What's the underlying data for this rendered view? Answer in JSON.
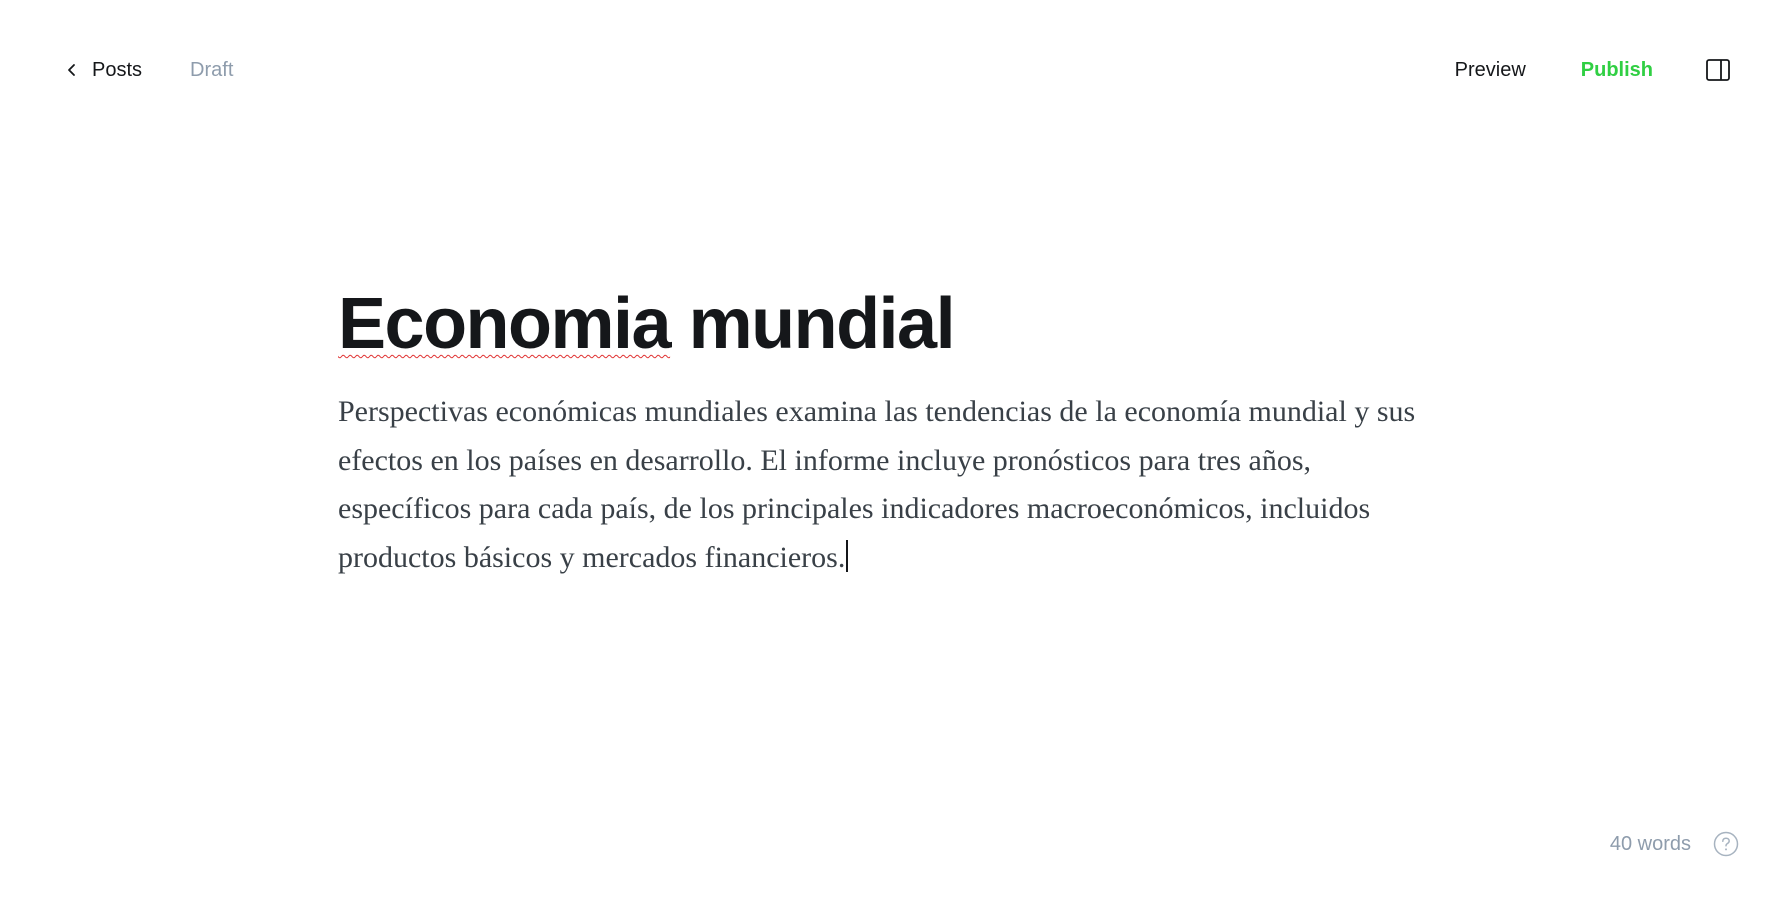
{
  "header": {
    "back_label": "Posts",
    "status": "Draft",
    "preview_label": "Preview",
    "publish_label": "Publish",
    "back_icon": "chevron-left-icon",
    "sidebar_icon": "sidebar-panel-icon"
  },
  "post": {
    "title_part1": "Economia",
    "title_part2": " mundial",
    "body": "Perspectivas económicas mundiales examina las tendencias de la economía mundial y sus efectos en los países en desarrollo. El informe incluye pronósticos para tres años, específicos para cada país, de los principales indicadores macroeconómicos, incluidos productos básicos y mercados financieros."
  },
  "footer": {
    "word_count": "40 words",
    "help_icon": "question-circle-icon"
  },
  "colors": {
    "publish": "#30cf43",
    "muted": "#8e9cac",
    "text": "#15171a",
    "body_text": "#394047"
  }
}
